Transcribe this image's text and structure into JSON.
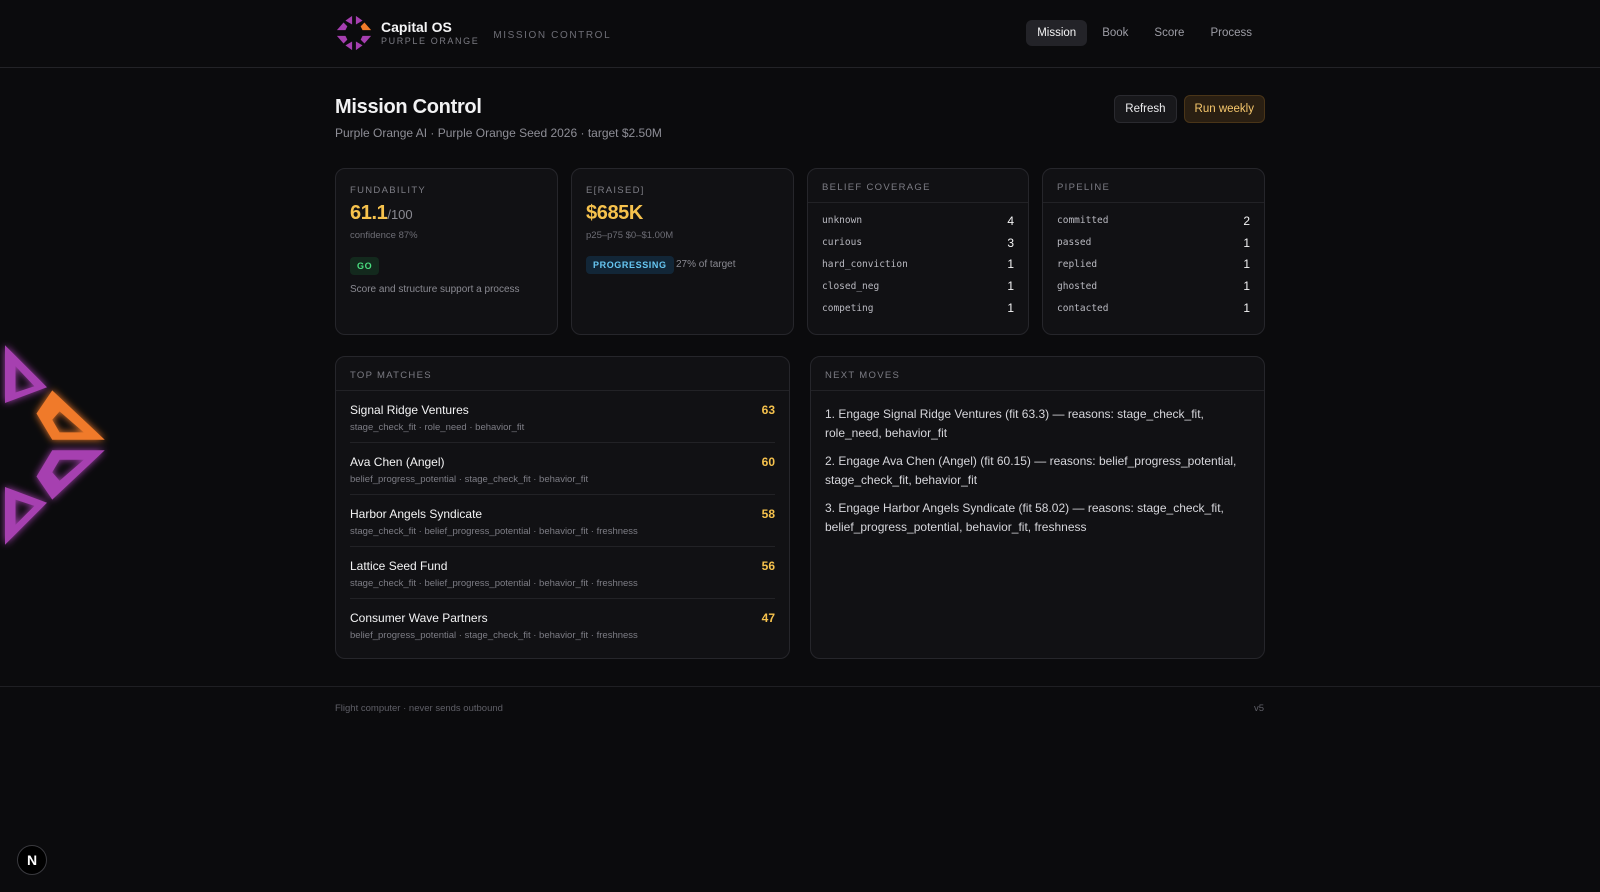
{
  "app": {
    "name": "Capital OS",
    "subtitle": "PURPLE ORANGE",
    "section": "MISSION CONTROL"
  },
  "nav": {
    "items": [
      {
        "label": "Mission",
        "active": true
      },
      {
        "label": "Book",
        "active": false
      },
      {
        "label": "Score",
        "active": false
      },
      {
        "label": "Process",
        "active": false
      }
    ]
  },
  "header": {
    "title": "Mission Control",
    "subtitle": "Purple Orange AI · Purple Orange Seed 2026 · target $2.50M",
    "refresh_label": "Refresh",
    "run_label": "Run weekly"
  },
  "fundability": {
    "label": "FUNDABILITY",
    "score": "61.1",
    "suffix": "/100",
    "confidence": "confidence 87%",
    "badge": "GO",
    "note": "Score and structure support a process"
  },
  "raised": {
    "label": "E[RAISED]",
    "value": "$685K",
    "range": "p25–p75 $0–$1.00M",
    "badge": "PROGRESSING",
    "progress_note": "27% of target"
  },
  "belief_coverage": {
    "label": "BELIEF COVERAGE",
    "rows": [
      {
        "key": "unknown",
        "value": "4"
      },
      {
        "key": "curious",
        "value": "3"
      },
      {
        "key": "hard_conviction",
        "value": "1"
      },
      {
        "key": "closed_neg",
        "value": "1"
      },
      {
        "key": "competing",
        "value": "1"
      }
    ]
  },
  "pipeline": {
    "label": "PIPELINE",
    "rows": [
      {
        "key": "committed",
        "value": "2"
      },
      {
        "key": "passed",
        "value": "1"
      },
      {
        "key": "replied",
        "value": "1"
      },
      {
        "key": "ghosted",
        "value": "1"
      },
      {
        "key": "contacted",
        "value": "1"
      }
    ]
  },
  "top_matches": {
    "label": "TOP MATCHES",
    "rows": [
      {
        "name": "Signal Ridge Ventures",
        "reasons": "stage_check_fit · role_need · behavior_fit",
        "score": "63"
      },
      {
        "name": "Ava Chen (Angel)",
        "reasons": "belief_progress_potential · stage_check_fit · behavior_fit",
        "score": "60"
      },
      {
        "name": "Harbor Angels Syndicate",
        "reasons": "stage_check_fit · belief_progress_potential · behavior_fit · freshness",
        "score": "58"
      },
      {
        "name": "Lattice Seed Fund",
        "reasons": "stage_check_fit · belief_progress_potential · behavior_fit · freshness",
        "score": "56"
      },
      {
        "name": "Consumer Wave Partners",
        "reasons": "belief_progress_potential · stage_check_fit · behavior_fit · freshness",
        "score": "47"
      }
    ]
  },
  "next_moves": {
    "label": "NEXT MOVES",
    "items": [
      "1. Engage Signal Ridge Ventures (fit 63.3) — reasons: stage_check_fit, role_need, behavior_fit",
      "2. Engage Ava Chen (Angel) (fit 60.15) — reasons: belief_progress_potential, stage_check_fit, behavior_fit",
      "3. Engage Harbor Angels Syndicate (fit 58.02) — reasons: stage_check_fit, belief_progress_potential, behavior_fit, freshness"
    ]
  },
  "footer": {
    "left": "Flight computer · never sends outbound",
    "right": "v5"
  },
  "badge_letter": "N",
  "colors": {
    "accent_gold": "#f6c24d",
    "brand_purple": "#a63fb0",
    "brand_orange": "#f07a2a",
    "go_green": "#4ade80",
    "progress_blue": "#67c7f3"
  },
  "icons": {
    "brand": "capital-os-logo",
    "emblem": "purple-orange-emblem",
    "framework": "next-n-badge"
  }
}
